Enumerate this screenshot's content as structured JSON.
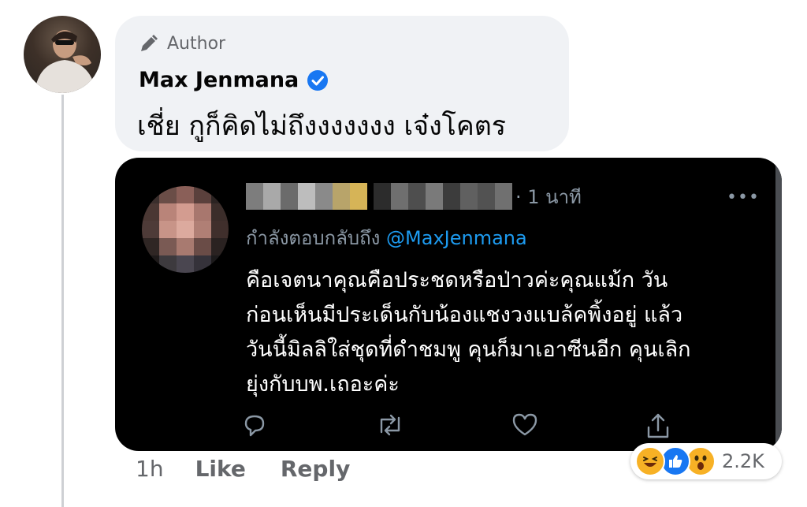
{
  "comment": {
    "author_badge": "Author",
    "name": "Max Jenmana",
    "text": "เชี่ย กูก็คิดไม่ถึงงงงงงง เจ๋งโคตร",
    "time": "1h",
    "like_label": "Like",
    "reply_label": "Reply"
  },
  "tweet": {
    "time": "· 1 นาที",
    "replying_to_label": "กำลังตอบกลับถึง",
    "mention": "@MaxJenmana",
    "body_lines": [
      "คือเจตนาคุณคือประชดหรือป่าวค่ะคุณแม้ก  วัน",
      "ก่อนเห็นมีประเด็นกับน้องแชงวงแบล้คพิ้งอยู่  แล้ว",
      "วันนี้มิลลิใส่ชุดที่ดำชมพู คุนก็มาเอาซีนอีก คุนเลิก",
      "ยุ่งกับบพ.เถอะค่ะ"
    ],
    "more_label": "•••"
  },
  "reactions": {
    "icons": [
      "laughing-icon",
      "like-icon",
      "wow-icon"
    ],
    "count": "2.2K"
  },
  "colors": {
    "accent_blue": "#1877f2",
    "twitter_blue": "#1d9bf0",
    "bubble_bg": "#f0f2f5",
    "muted": "#65676b"
  }
}
